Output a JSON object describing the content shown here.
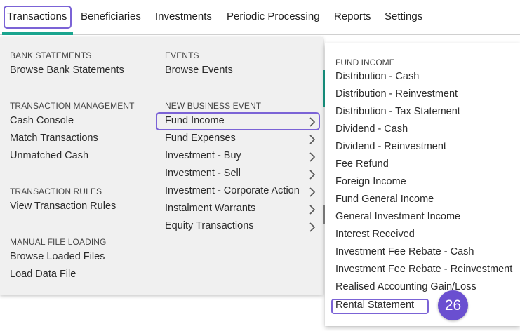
{
  "nav": {
    "transactions": "Transactions",
    "beneficiaries": "Beneficiaries",
    "investments": "Investments",
    "periodic_processing": "Periodic Processing",
    "reports": "Reports",
    "settings": "Settings"
  },
  "mega": {
    "bank_statements": {
      "heading": "BANK STATEMENTS",
      "browse": "Browse Bank Statements"
    },
    "transaction_management": {
      "heading": "TRANSACTION MANAGEMENT",
      "cash_console": "Cash Console",
      "match": "Match Transactions",
      "unmatched": "Unmatched Cash"
    },
    "transaction_rules": {
      "heading": "TRANSACTION RULES",
      "view": "View Transaction Rules"
    },
    "manual_file_loading": {
      "heading": "MANUAL FILE LOADING",
      "browse": "Browse Loaded Files",
      "load": "Load Data File"
    },
    "events": {
      "heading": "EVENTS",
      "browse": "Browse Events"
    },
    "new_business_event": {
      "heading": "NEW BUSINESS EVENT",
      "items": [
        "Fund Income",
        "Fund Expenses",
        "Investment - Buy",
        "Investment - Sell",
        "Investment - Corporate Action",
        "Instalment Warrants",
        "Equity Transactions"
      ]
    }
  },
  "submenu": {
    "heading": "FUND INCOME",
    "items": [
      "Distribution - Cash",
      "Distribution - Reinvestment",
      "Distribution - Tax Statement",
      "Dividend - Cash",
      "Dividend - Reinvestment",
      "Fee Refund",
      "Foreign Income",
      "Fund General Income",
      "General Investment Income",
      "Interest Received",
      "Investment Fee Rebate - Cash",
      "Investment Fee Rebate - Reinvestment",
      "Realised Accounting Gain/Loss",
      "Rental Statement"
    ]
  },
  "badge": "26",
  "colors": {
    "accent": "#7b63d6",
    "active_underline": "#1aa58f",
    "badge": "#6a4fd0"
  }
}
